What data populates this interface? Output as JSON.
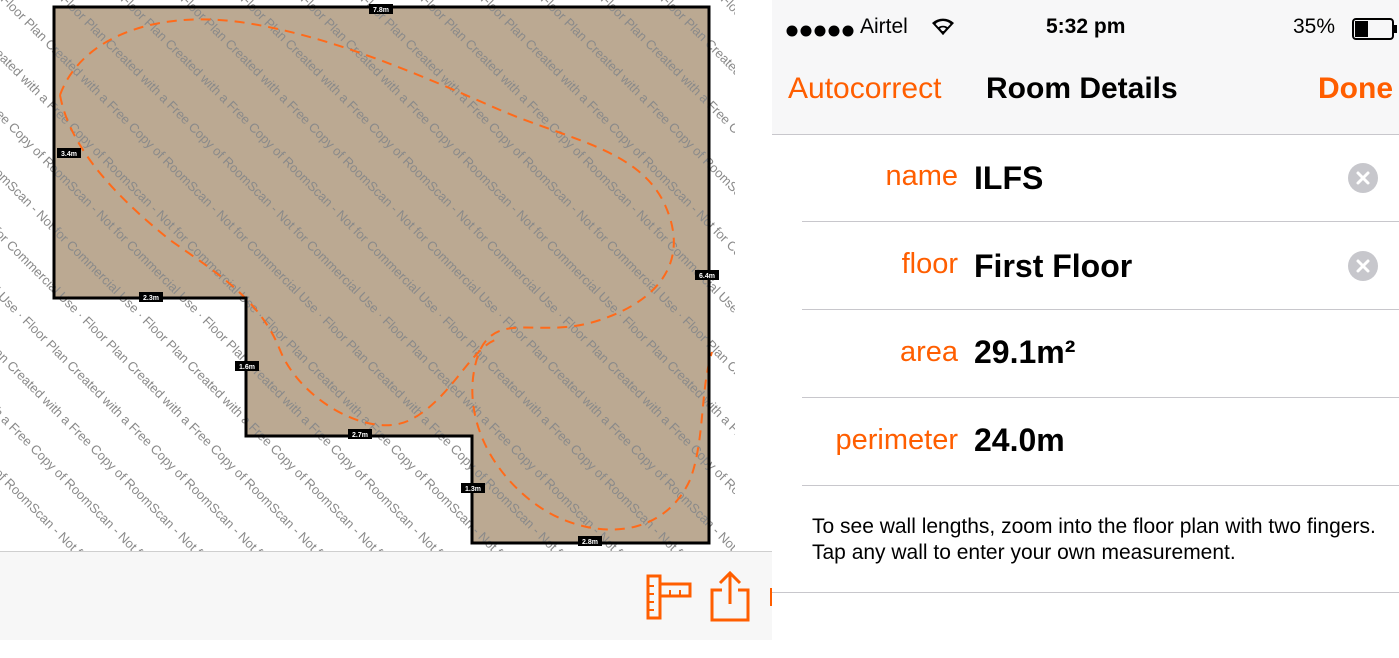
{
  "status_bar": {
    "carrier": "Airtel",
    "time": "5:32 pm",
    "battery_percent": "35%",
    "battery_level": 0.35,
    "signal_icon": "signal-dots-icon",
    "wifi_icon": "wifi-icon"
  },
  "nav": {
    "left_button": "Autocorrect",
    "title": "Room Details",
    "right_button": "Done"
  },
  "fields": {
    "name": {
      "label": "name",
      "value": "ILFS"
    },
    "floor": {
      "label": "floor",
      "value": "First Floor"
    },
    "area": {
      "label": "area",
      "value": "29.1m²"
    },
    "perimeter": {
      "label": "perimeter",
      "value": "24.0m"
    }
  },
  "hint": "To see wall lengths, zoom into the floor plan with two fingers. Tap any wall to enter your own measurement.",
  "floor_plan": {
    "watermark": "Floor Plan Created with a Free Copy of RoomScan - Not for Commercial Use",
    "walls": {
      "top": "7.8m",
      "left": "3.4m",
      "right": "6.4m",
      "step_top": "2.3m",
      "step_left": "1.6m",
      "middle": "2.7m",
      "step_right": "1.3m",
      "bottom": "2.8m"
    }
  },
  "toolbar": {
    "measure_icon": "ruler-icon",
    "share_icon": "share-icon"
  },
  "colors": {
    "accent": "#ff5e00",
    "room_fill": "#bba992",
    "trace": "#ff6a1a"
  }
}
